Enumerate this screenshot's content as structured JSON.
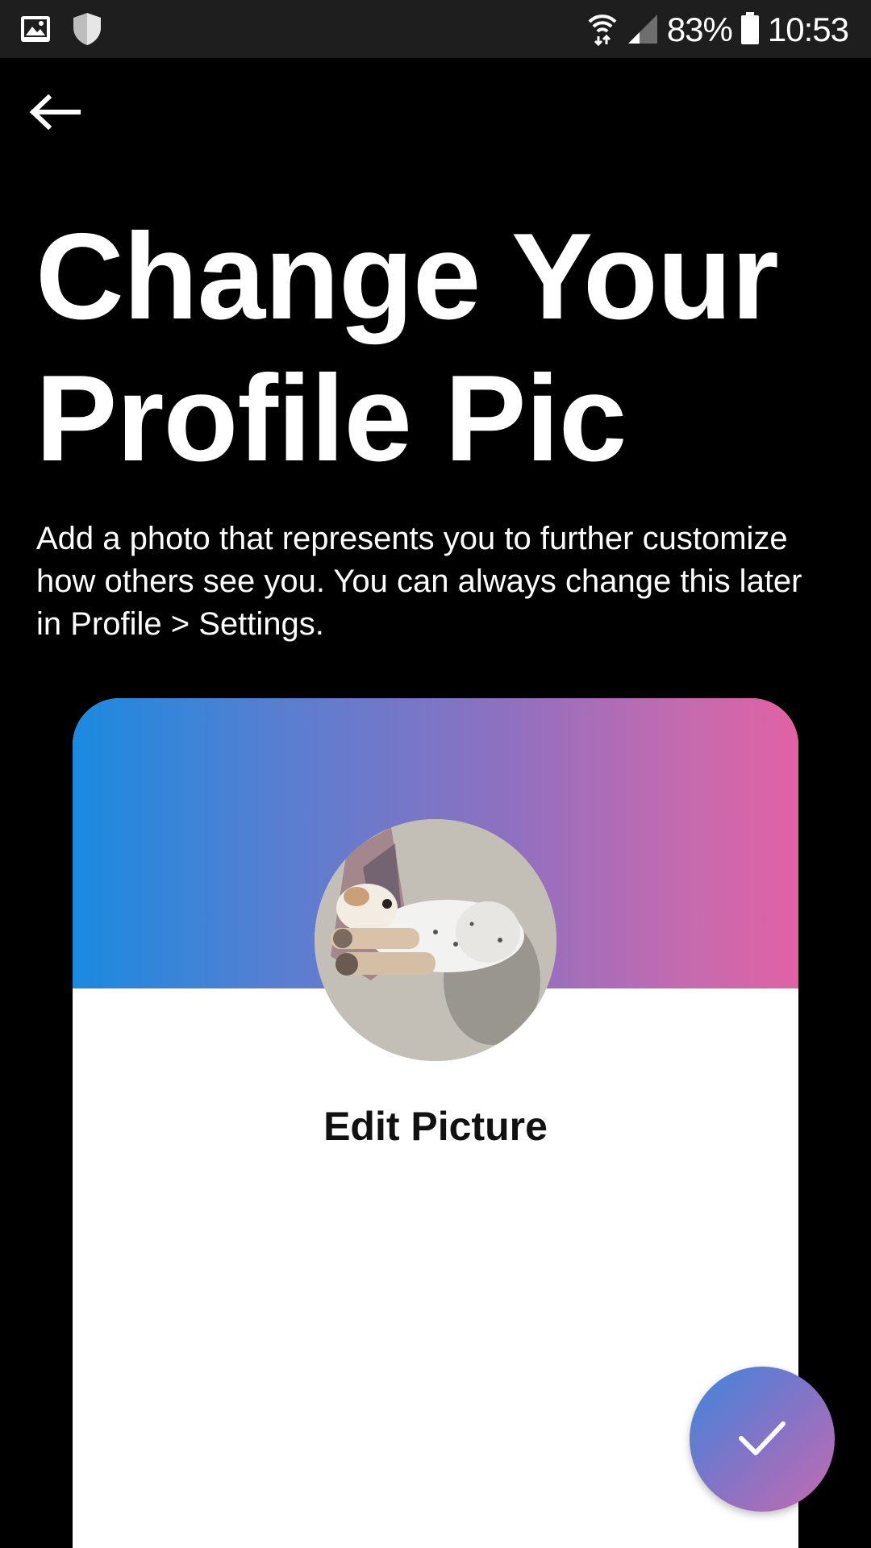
{
  "status_bar": {
    "battery_percent": "83%",
    "time": "10:53",
    "icons": [
      "gallery-icon",
      "shield-icon",
      "wifi-icon",
      "signal-icon",
      "battery-icon"
    ]
  },
  "header": {
    "back_icon": "arrow-left-icon"
  },
  "main": {
    "title_line1": "Change Your",
    "title_line2": "Profile Pic",
    "description": "Add a photo that represents you to further customize how others see you. You can always change this later in Profile > Settings."
  },
  "card": {
    "edit_label": "Edit Picture",
    "gradient_colors": [
      "#1a8ae0",
      "#e062a3"
    ]
  },
  "fab": {
    "icon": "checkmark-icon",
    "gradient_colors": [
      "#3d86dc",
      "#c56bb0"
    ]
  }
}
